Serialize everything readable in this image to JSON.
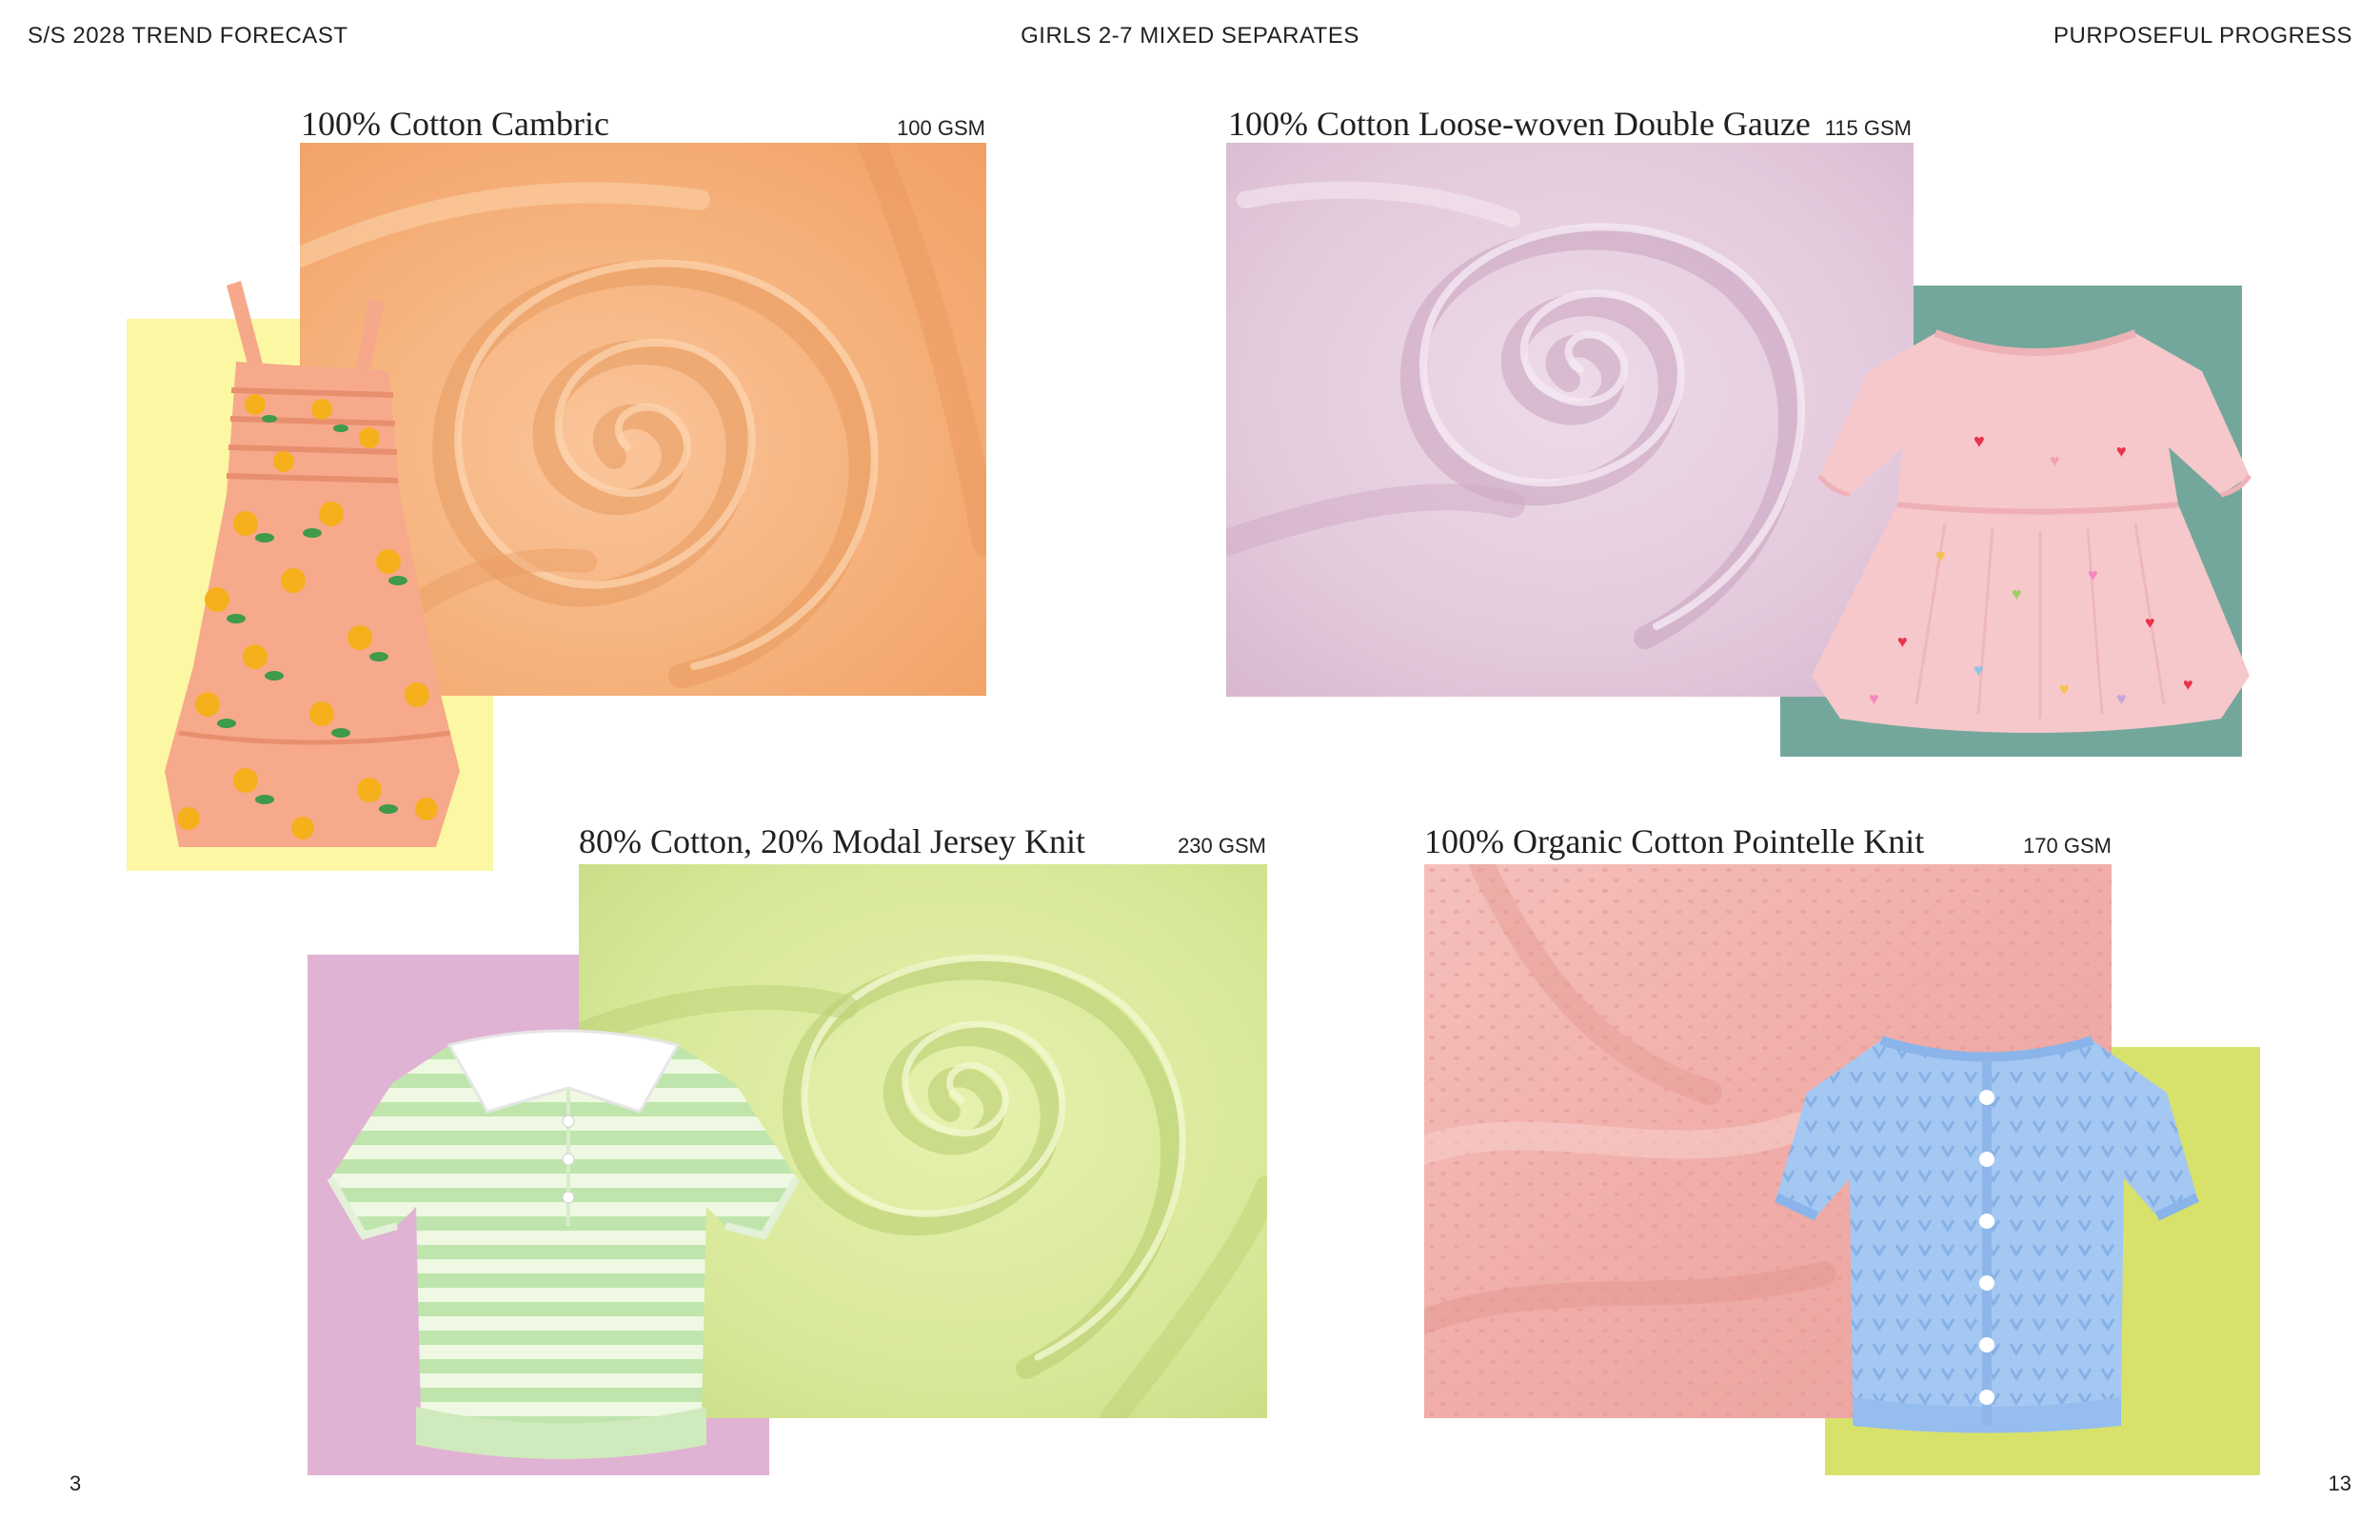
{
  "header": {
    "left": "S/S 2028 TREND FORECAST",
    "center": "GIRLS 2-7 MIXED SEPARATES",
    "right": "PURPOSEFUL PROGRESS"
  },
  "footer": {
    "page_left": "3",
    "page_right": "13"
  },
  "fabrics": [
    {
      "title": "100% Cotton Cambric",
      "weight": "100 GSM",
      "swatch_color": "#f7b886",
      "block_color": "#fbf7a3",
      "garment": "floral-smocked-dress-icon"
    },
    {
      "title": "100% Cotton Loose-woven Double Gauze",
      "weight": "115 GSM",
      "swatch_color": "#e6cde0",
      "block_color": "#74a79c",
      "garment": "pink-heart-dress-icon"
    },
    {
      "title": "80% Cotton, 20% Modal Jersey Knit",
      "weight": "230 GSM",
      "swatch_color": "#d9e99a",
      "block_color": "#e0b2d3",
      "garment": "striped-polo-top-icon"
    },
    {
      "title": "100% Organic Cotton Pointelle Knit",
      "weight": "170 GSM",
      "swatch_color": "#f2b4b0",
      "block_color": "#d8e26a",
      "garment": "blue-pointelle-cardigan-icon"
    }
  ]
}
